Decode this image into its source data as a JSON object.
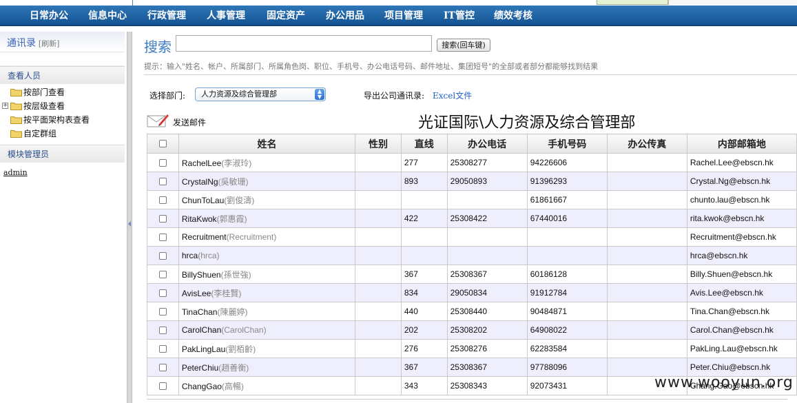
{
  "nav": {
    "items": [
      "日常办公",
      "信息中心",
      "行政管理",
      "人事管理",
      "固定资产",
      "办公用品",
      "项目管理",
      "IT管控",
      "绩效考核"
    ]
  },
  "sidebar": {
    "title": "通讯录",
    "refresh": "[刷新]",
    "section_people": "查看人员",
    "tree": [
      "按部门查看",
      "按层级查看",
      "按平面架构表查看",
      "自定群组"
    ],
    "section_admin": "模块管理员",
    "admin_user": "admin"
  },
  "search": {
    "title": "搜索",
    "input_value": "",
    "button": "搜索(回车键)",
    "hint": "提示：输入\"姓名、帐户、所属部门、所属角色岗、职位、手机号、办公电话号码、邮件地址、集团短号\"的全部或者部分都能够找到结果"
  },
  "filter": {
    "dept_label": "选择部门:",
    "dept_selected": "人力资源及综合管理部",
    "export_label": "导出公司通讯录:",
    "export_link": "Excel文件"
  },
  "mail": {
    "label": "发送邮件"
  },
  "dept_heading": "光证国际\\人力资源及综合管理部",
  "table": {
    "headers": [
      "姓名",
      "性别",
      "直线",
      "办公电话",
      "手机号码",
      "办公传真",
      "内部邮箱地"
    ],
    "rows": [
      {
        "name": "RachelLee",
        "cn": "(李淑玲)",
        "gender": "",
        "direct": "277",
        "office": "25308277",
        "mobile": "94226606",
        "fax": "",
        "email": "Rachel.Lee@ebscn.hk"
      },
      {
        "name": "CrystalNg",
        "cn": "(吳敏珊)",
        "gender": "",
        "direct": "893",
        "office": "29050893",
        "mobile": "91396293",
        "fax": "",
        "email": "Crystal.Ng@ebscn.hk"
      },
      {
        "name": "ChunToLau",
        "cn": "(劉俊濤)",
        "gender": "",
        "direct": "",
        "office": "",
        "mobile": "61861667",
        "fax": "",
        "email": "chunto.lau@ebscn.hk"
      },
      {
        "name": "RitaKwok",
        "cn": "(郭惠霞)",
        "gender": "",
        "direct": "422",
        "office": "25308422",
        "mobile": "67440016",
        "fax": "",
        "email": "rita.kwok@ebscn.hk"
      },
      {
        "name": "Recruitment",
        "cn": "(Recruitment)",
        "gender": "",
        "direct": "",
        "office": "",
        "mobile": "",
        "fax": "",
        "email": "Recruitment@ebscn.hk"
      },
      {
        "name": "hrca",
        "cn": "(hrca)",
        "gender": "",
        "direct": "",
        "office": "",
        "mobile": "",
        "fax": "",
        "email": "hrca@ebscn.hk"
      },
      {
        "name": "BillyShuen",
        "cn": "(孫世強)",
        "gender": "",
        "direct": "367",
        "office": "25308367",
        "mobile": "60186128",
        "fax": "",
        "email": "Billy.Shuen@ebscn.hk"
      },
      {
        "name": "AvisLee",
        "cn": "(李桂賢)",
        "gender": "",
        "direct": "834",
        "office": "29050834",
        "mobile": "91912784",
        "fax": "",
        "email": "Avis.Lee@ebscn.hk"
      },
      {
        "name": "TinaChan",
        "cn": "(陳麗婷)",
        "gender": "",
        "direct": "440",
        "office": "25308440",
        "mobile": "90484871",
        "fax": "",
        "email": "Tina.Chan@ebscn.hk"
      },
      {
        "name": "CarolChan",
        "cn": "(CarolChan)",
        "gender": "",
        "direct": "202",
        "office": "25308202",
        "mobile": "64908022",
        "fax": "",
        "email": "Carol.Chan@ebscn.hk"
      },
      {
        "name": "PakLingLau",
        "cn": "(劉栢齡)",
        "gender": "",
        "direct": "276",
        "office": "25308276",
        "mobile": "62283584",
        "fax": "",
        "email": "PakLing.Lau@ebscn.hk"
      },
      {
        "name": "PeterChiu",
        "cn": "(趙善衡)",
        "gender": "",
        "direct": "367",
        "office": "25308367",
        "mobile": "97788096",
        "fax": "",
        "email": "Peter.Chiu@ebscn.hk"
      },
      {
        "name": "ChangGao",
        "cn": "(高暢)",
        "gender": "",
        "direct": "343",
        "office": "25308343",
        "mobile": "92073431",
        "fax": "",
        "email": "Chang.Gao@ebscn.hk"
      }
    ]
  },
  "watermark": "www.wooyun.org",
  "colors": {
    "nav_top": "#2f77b8",
    "nav_bottom": "#145393",
    "accent": "#3b7cc1",
    "row_alt": "#eeeefc",
    "link": "#1f5fc9"
  }
}
